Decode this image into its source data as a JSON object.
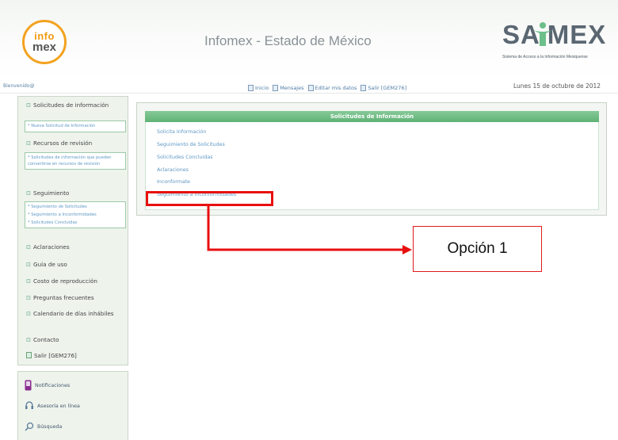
{
  "header": {
    "logo_top": "info",
    "logo_bottom": "mex",
    "title": "Infomex - Estado de México",
    "brand_word": "SA MEX",
    "brand_tagline": "Sistema de Acceso a la Información Mexiquense"
  },
  "toolbar": {
    "welcome": "Bienvenido@",
    "links": [
      {
        "label": "Inicio",
        "icon": "home-icon"
      },
      {
        "label": "Mensajes",
        "icon": "mail-icon"
      },
      {
        "label": "Editar mis datos",
        "icon": "edit-icon"
      },
      {
        "label": "Salir [GEM276]",
        "icon": "logout-icon"
      }
    ],
    "date": "Lunes 15 de octubre de 2012"
  },
  "sidebar": {
    "solicitudes": "Solicitudes de información",
    "nueva_solicitud": "* Nueva Solicitud de Información",
    "recursos": "Recursos de revisión",
    "recursos_sub": "* Solicitudes de información que pueden convertirse en recursos de revisión",
    "seguimiento": "Seguimiento",
    "seguimiento_sub": [
      "* Seguimiento de Solicitudes",
      "* Seguimiento a Inconformidades",
      "* Solicitudes Concluidas"
    ],
    "items": [
      "Aclaraciones",
      "Guía de uso",
      "Costo de reproducción",
      "Preguntas frecuentes",
      "Calendario de días inhábiles",
      "Contacto"
    ],
    "salir": "Salir [GEM276]",
    "tools": [
      {
        "label": "Notificaciones",
        "icon": "phone-icon"
      },
      {
        "label": "Asesoría en línea",
        "icon": "headset-icon"
      },
      {
        "label": "Búsqueda",
        "icon": "search-icon"
      }
    ]
  },
  "panel": {
    "header": "Solicitudes de Información",
    "links": [
      "Solicita Información",
      "Seguimiento de Solicitudes",
      "Solicitudes Concluidas",
      "Aclaraciones",
      "Inconformate",
      "Seguimiento a Inconformidades"
    ]
  },
  "annotation": {
    "callout": "Opción 1",
    "color": "#e01a1a"
  }
}
